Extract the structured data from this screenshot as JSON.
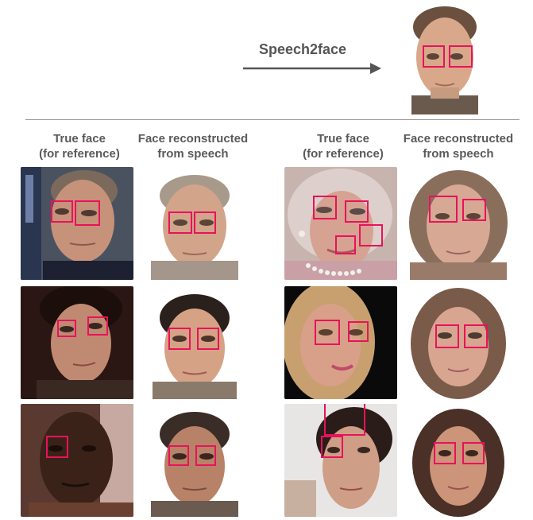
{
  "diagram": {
    "arrow_label": "Speech2face",
    "left_group": {
      "col1_header_l1": "True face",
      "col1_header_l2": "(for reference)",
      "col2_header_l1": "Face reconstructed",
      "col2_header_l2": "from speech"
    },
    "right_group": {
      "col1_header_l1": "True face",
      "col1_header_l2": "(for reference)",
      "col2_header_l1": "Face reconstructed",
      "col2_header_l2": "from speech"
    }
  },
  "colors": {
    "highlight": "#e8125c",
    "waveform_start": "#2aa9b0",
    "waveform_end": "#3b4aa0",
    "header_text": "#5a5a5a"
  }
}
